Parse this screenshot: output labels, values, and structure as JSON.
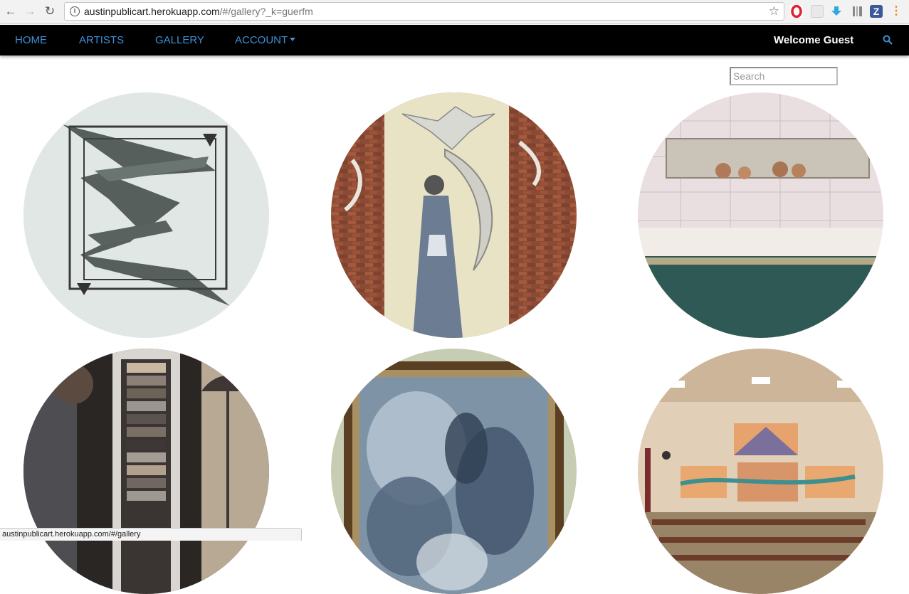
{
  "browser": {
    "url_host": "austinpublicart.herokuapp.com",
    "url_path": "/#/gallery?_k=guerfm",
    "status_url": "austinpublicart.herokuapp.com/#/gallery"
  },
  "nav": {
    "home": "HOME",
    "artists": "ARTISTS",
    "gallery": "GALLERY",
    "account": "ACCOUNT",
    "welcome": "Welcome Guest"
  },
  "search": {
    "placeholder": "Search"
  },
  "colors": {
    "nav_bg": "#000000",
    "link": "#3f8fd8"
  },
  "gallery": {
    "items": [
      "abstract-sketch-artwork",
      "brick-wall-relief-sculpture",
      "children-at-sinks-photo",
      "door-panel-sculpture",
      "framed-blue-painting",
      "cafeteria-mural-photo"
    ]
  }
}
